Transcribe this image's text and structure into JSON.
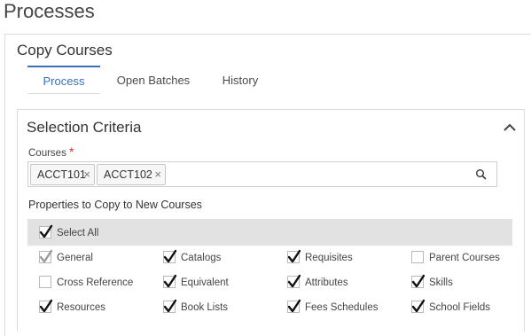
{
  "page": {
    "title": "Processes"
  },
  "card": {
    "title": "Copy Courses"
  },
  "tabs": [
    {
      "label": "Process",
      "active": true
    },
    {
      "label": "Open Batches",
      "active": false
    },
    {
      "label": "History",
      "active": false
    }
  ],
  "selection": {
    "title": "Selection Criteria",
    "collapse_icon": "chevron-up-icon",
    "courses_label": "Courses",
    "required_marker": "*",
    "chips": [
      "ACCT101",
      "ACCT102"
    ],
    "chip_remove_glyph": "×",
    "search_icon": "search-icon"
  },
  "properties": {
    "label": "Properties to Copy to New Courses",
    "select_all": {
      "label": "Select All",
      "checked": true
    },
    "items": [
      {
        "label": "General",
        "checked": true,
        "disabled": true
      },
      {
        "label": "Catalogs",
        "checked": true
      },
      {
        "label": "Requisites",
        "checked": true
      },
      {
        "label": "Parent Courses",
        "checked": false
      },
      {
        "label": "Cross Reference",
        "checked": false
      },
      {
        "label": "Equivalent",
        "checked": true
      },
      {
        "label": "Attributes",
        "checked": true
      },
      {
        "label": "Skills",
        "checked": true
      },
      {
        "label": "Resources",
        "checked": true
      },
      {
        "label": "Book Lists",
        "checked": true
      },
      {
        "label": "Fees Schedules",
        "checked": true
      },
      {
        "label": "School Fields",
        "checked": true
      }
    ]
  },
  "colors": {
    "accent": "#3a6fb5",
    "required": "#d0342c",
    "select_all_bg": "#e2e2e2"
  }
}
